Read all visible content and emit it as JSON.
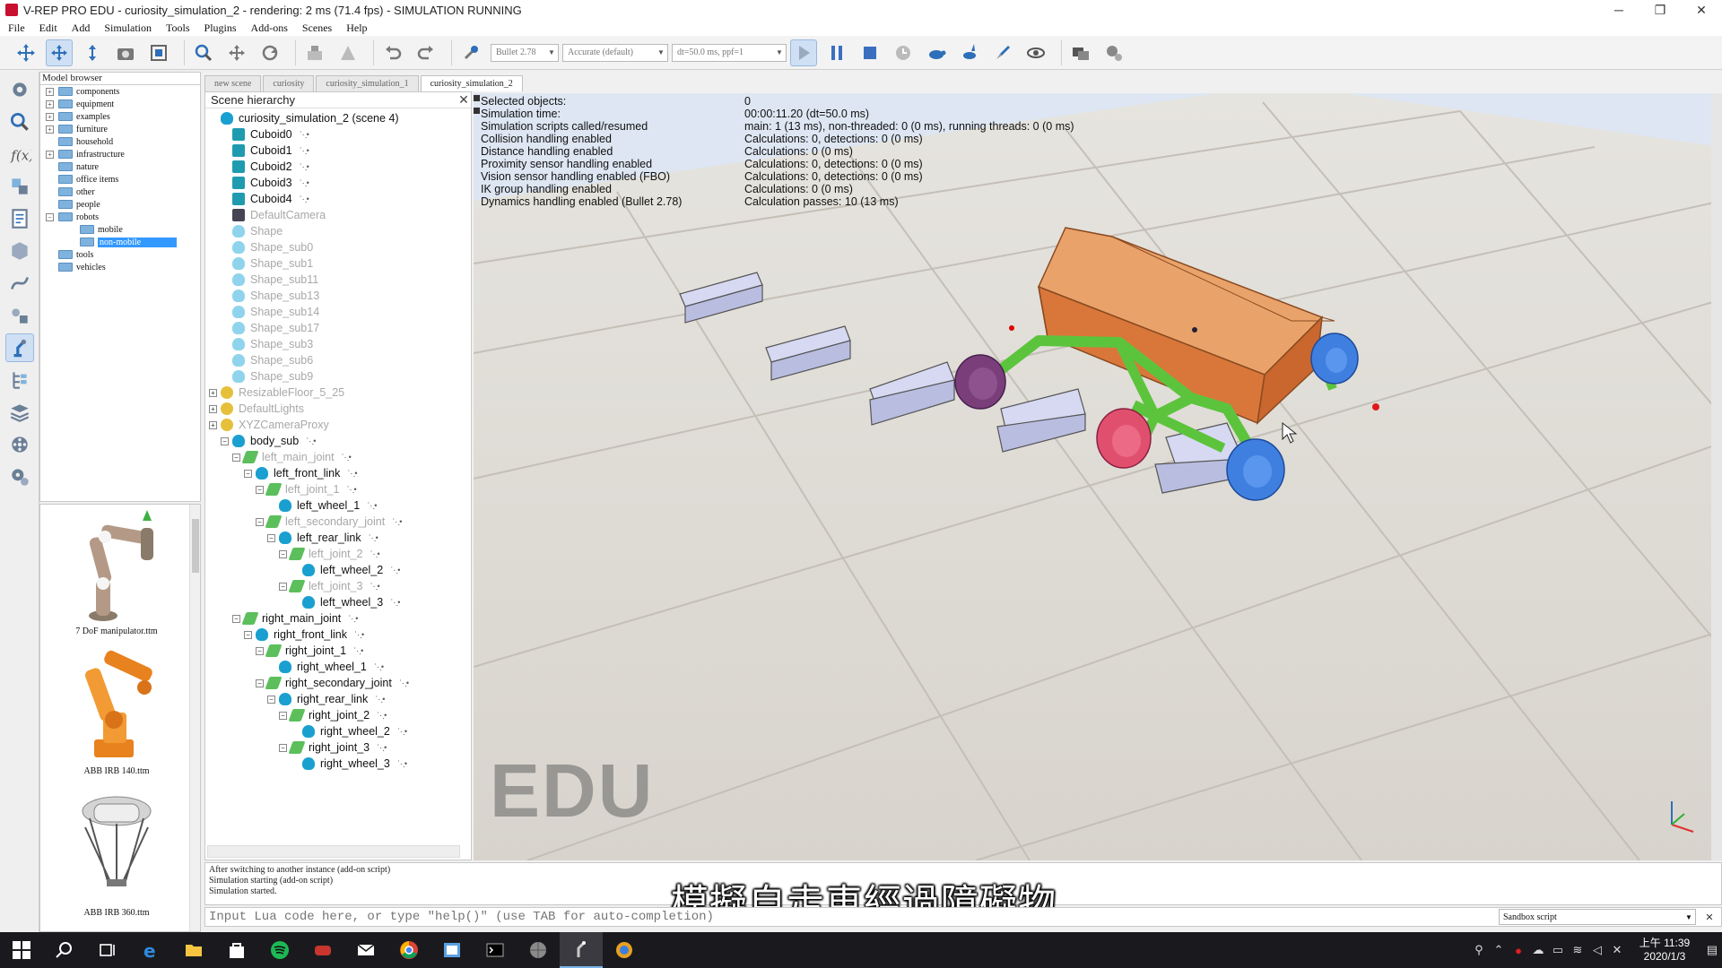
{
  "window": {
    "title": "V-REP PRO EDU - curiosity_simulation_2 - rendering: 2 ms (71.4 fps) - SIMULATION RUNNING",
    "minimize": "─",
    "restore": "❐",
    "close": "✕"
  },
  "menus": [
    "File",
    "Edit",
    "Add",
    "Simulation",
    "Tools",
    "Plugins",
    "Add-ons",
    "Scenes",
    "Help"
  ],
  "toolbar": {
    "engine": "Bullet 2.78",
    "accuracy": "Accurate (default)",
    "timestep": "dt=50.0 ms, ppf=1"
  },
  "model_browser": {
    "header": "Model browser",
    "items": [
      {
        "label": "components",
        "indent": 0,
        "expander": "+"
      },
      {
        "label": "equipment",
        "indent": 0,
        "expander": "+"
      },
      {
        "label": "examples",
        "indent": 0,
        "expander": "+"
      },
      {
        "label": "furniture",
        "indent": 0,
        "expander": "+"
      },
      {
        "label": "household",
        "indent": 0,
        "expander": ""
      },
      {
        "label": "infrastructure",
        "indent": 0,
        "expander": "+"
      },
      {
        "label": "nature",
        "indent": 0,
        "expander": ""
      },
      {
        "label": "office items",
        "indent": 0,
        "expander": ""
      },
      {
        "label": "other",
        "indent": 0,
        "expander": ""
      },
      {
        "label": "people",
        "indent": 0,
        "expander": ""
      },
      {
        "label": "robots",
        "indent": 0,
        "expander": "−"
      },
      {
        "label": "mobile",
        "indent": 1,
        "expander": ""
      },
      {
        "label": "non-mobile",
        "indent": 1,
        "expander": "",
        "selected": true
      },
      {
        "label": "tools",
        "indent": 0,
        "expander": ""
      },
      {
        "label": "vehicles",
        "indent": 0,
        "expander": ""
      }
    ],
    "thumbnails": [
      "7 DoF manipulator.ttm",
      "ABB IRB 140.ttm",
      "ABB IRB 360.ttm"
    ]
  },
  "scene_tabs": [
    "new scene",
    "curiosity",
    "curiosity_simulation_1",
    "curiosity_simulation_2"
  ],
  "hierarchy": {
    "header": "Scene hierarchy",
    "close": "✕",
    "rows": [
      {
        "label": "curiosity_simulation_2 (scene 4)",
        "indent": 0,
        "icon": "scene",
        "ghost": false,
        "script": false,
        "tog": ""
      },
      {
        "label": "Cuboid0",
        "indent": 1,
        "icon": "cube",
        "ghost": false,
        "script": true,
        "tog": ""
      },
      {
        "label": "Cuboid1",
        "indent": 1,
        "icon": "cube",
        "ghost": false,
        "script": true,
        "tog": ""
      },
      {
        "label": "Cuboid2",
        "indent": 1,
        "icon": "cube",
        "ghost": false,
        "script": true,
        "tog": ""
      },
      {
        "label": "Cuboid3",
        "indent": 1,
        "icon": "cube",
        "ghost": false,
        "script": true,
        "tog": ""
      },
      {
        "label": "Cuboid4",
        "indent": 1,
        "icon": "cube",
        "ghost": false,
        "script": true,
        "tog": ""
      },
      {
        "label": "DefaultCamera",
        "indent": 1,
        "icon": "cam",
        "ghost": true,
        "script": false,
        "tog": ""
      },
      {
        "label": "Shape",
        "indent": 1,
        "icon": "shape",
        "ghost": true,
        "script": false,
        "tog": ""
      },
      {
        "label": "Shape_sub0",
        "indent": 1,
        "icon": "shape",
        "ghost": true,
        "script": false,
        "tog": ""
      },
      {
        "label": "Shape_sub1",
        "indent": 1,
        "icon": "shape",
        "ghost": true,
        "script": false,
        "tog": ""
      },
      {
        "label": "Shape_sub11",
        "indent": 1,
        "icon": "shape",
        "ghost": true,
        "script": false,
        "tog": ""
      },
      {
        "label": "Shape_sub13",
        "indent": 1,
        "icon": "shape",
        "ghost": true,
        "script": false,
        "tog": ""
      },
      {
        "label": "Shape_sub14",
        "indent": 1,
        "icon": "shape",
        "ghost": true,
        "script": false,
        "tog": ""
      },
      {
        "label": "Shape_sub17",
        "indent": 1,
        "icon": "shape",
        "ghost": true,
        "script": false,
        "tog": ""
      },
      {
        "label": "Shape_sub3",
        "indent": 1,
        "icon": "shape",
        "ghost": true,
        "script": false,
        "tog": ""
      },
      {
        "label": "Shape_sub6",
        "indent": 1,
        "icon": "shape",
        "ghost": true,
        "script": false,
        "tog": ""
      },
      {
        "label": "Shape_sub9",
        "indent": 1,
        "icon": "shape",
        "ghost": true,
        "script": false,
        "tog": ""
      },
      {
        "label": "ResizableFloor_5_25",
        "indent": 0,
        "icon": "dummy",
        "ghost": true,
        "script": false,
        "tog": "+"
      },
      {
        "label": "DefaultLights",
        "indent": 0,
        "icon": "dummy",
        "ghost": true,
        "script": false,
        "tog": "+"
      },
      {
        "label": "XYZCameraProxy",
        "indent": 0,
        "icon": "dummy",
        "ghost": true,
        "script": false,
        "tog": "+"
      },
      {
        "label": "body_sub",
        "indent": 1,
        "icon": "shape dark",
        "ghost": false,
        "script": true,
        "tog": "−"
      },
      {
        "label": "left_main_joint",
        "indent": 2,
        "icon": "joint",
        "ghost": true,
        "script": true,
        "tog": "−"
      },
      {
        "label": "left_front_link",
        "indent": 3,
        "icon": "shape dark",
        "ghost": false,
        "script": true,
        "tog": "−"
      },
      {
        "label": "left_joint_1",
        "indent": 4,
        "icon": "joint",
        "ghost": true,
        "script": true,
        "tog": "−"
      },
      {
        "label": "left_wheel_1",
        "indent": 5,
        "icon": "shape dark",
        "ghost": false,
        "script": true,
        "tog": ""
      },
      {
        "label": "left_secondary_joint",
        "indent": 4,
        "icon": "joint",
        "ghost": true,
        "script": true,
        "tog": "−"
      },
      {
        "label": "left_rear_link",
        "indent": 5,
        "icon": "shape dark",
        "ghost": false,
        "script": true,
        "tog": "−"
      },
      {
        "label": "left_joint_2",
        "indent": 6,
        "icon": "joint",
        "ghost": true,
        "script": true,
        "tog": "−"
      },
      {
        "label": "left_wheel_2",
        "indent": 7,
        "icon": "shape dark",
        "ghost": false,
        "script": true,
        "tog": ""
      },
      {
        "label": "left_joint_3",
        "indent": 6,
        "icon": "joint",
        "ghost": true,
        "script": true,
        "tog": "−"
      },
      {
        "label": "left_wheel_3",
        "indent": 7,
        "icon": "shape dark",
        "ghost": false,
        "script": true,
        "tog": ""
      },
      {
        "label": "right_main_joint",
        "indent": 2,
        "icon": "joint",
        "ghost": false,
        "script": true,
        "tog": "−"
      },
      {
        "label": "right_front_link",
        "indent": 3,
        "icon": "shape dark",
        "ghost": false,
        "script": true,
        "tog": "−"
      },
      {
        "label": "right_joint_1",
        "indent": 4,
        "icon": "joint",
        "ghost": false,
        "script": true,
        "tog": "−"
      },
      {
        "label": "right_wheel_1",
        "indent": 5,
        "icon": "shape dark",
        "ghost": false,
        "script": true,
        "tog": ""
      },
      {
        "label": "right_secondary_joint",
        "indent": 4,
        "icon": "joint",
        "ghost": false,
        "script": true,
        "tog": "−"
      },
      {
        "label": "right_rear_link",
        "indent": 5,
        "icon": "shape dark",
        "ghost": false,
        "script": true,
        "tog": "−"
      },
      {
        "label": "right_joint_2",
        "indent": 6,
        "icon": "joint",
        "ghost": false,
        "script": true,
        "tog": "−"
      },
      {
        "label": "right_wheel_2",
        "indent": 7,
        "icon": "shape dark",
        "ghost": false,
        "script": true,
        "tog": ""
      },
      {
        "label": "right_joint_3",
        "indent": 6,
        "icon": "joint",
        "ghost": false,
        "script": true,
        "tog": "−"
      },
      {
        "label": "right_wheel_3",
        "indent": 7,
        "icon": "shape dark",
        "ghost": false,
        "script": true,
        "tog": ""
      }
    ]
  },
  "info_overlay": [
    {
      "key": "Selected objects:",
      "value": "0"
    },
    {
      "key": "Simulation time:",
      "value": "00:00:11.20 (dt=50.0 ms)"
    },
    {
      "key": "Simulation scripts called/resumed",
      "value": "main: 1 (13 ms), non-threaded: 0 (0 ms), running threads: 0 (0 ms)"
    },
    {
      "key": "Collision handling enabled",
      "value": "Calculations: 0, detections: 0 (0 ms)"
    },
    {
      "key": "Distance handling enabled",
      "value": "Calculations: 0 (0 ms)"
    },
    {
      "key": "Proximity sensor handling enabled",
      "value": "Calculations: 0, detections: 0 (0 ms)"
    },
    {
      "key": "Vision sensor handling enabled (FBO)",
      "value": "Calculations: 0, detections: 0 (0 ms)"
    },
    {
      "key": "IK group handling enabled",
      "value": "Calculations: 0 (0 ms)"
    },
    {
      "key": "Dynamics handling enabled (Bullet 2.78)",
      "value": "Calculation passes: 10 (13 ms)"
    }
  ],
  "watermark": "EDU",
  "console": {
    "lines": [
      "After switching to another instance (add-on script)",
      "Simulation starting (add-on script)",
      "Simulation started."
    ]
  },
  "subtitle": "模擬自走車經過障礙物",
  "lua": {
    "placeholder": "Input Lua code here, or type \"help()\" (use TAB for auto-completion)",
    "sandbox": "Sandbox script"
  },
  "taskbar": {
    "time": "上午 11:39",
    "date": "2020/1/3"
  },
  "colors": {
    "accent": "#3399ff",
    "rover_body": "#e08a4a",
    "rover_links": "#5cc43c",
    "wheel_blue": "#3f7fe0",
    "wheel_red": "#e0506e",
    "wheel_purple": "#7a3f7a",
    "obstacle": "#c8cceb"
  }
}
